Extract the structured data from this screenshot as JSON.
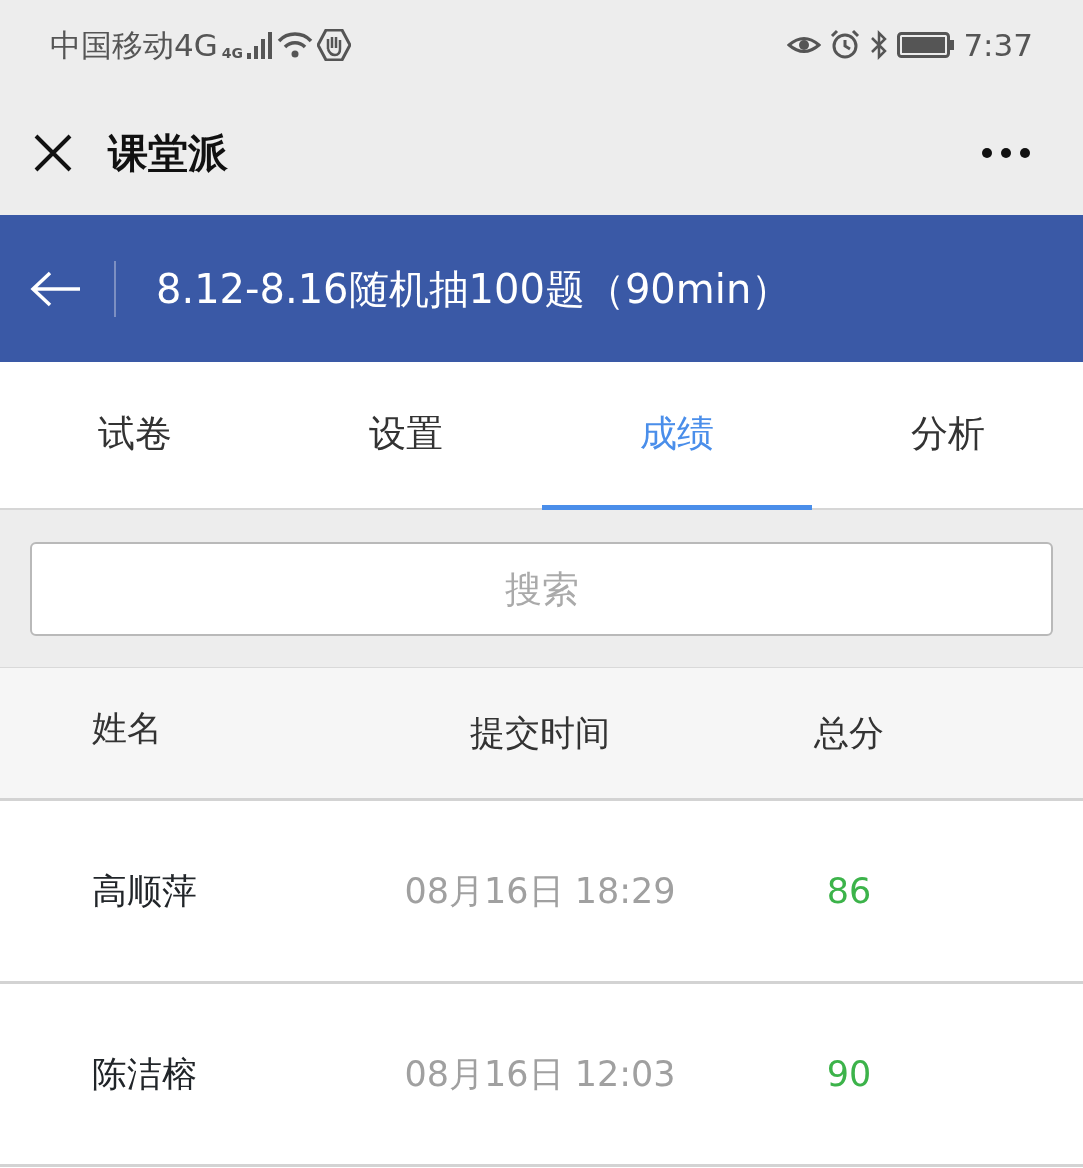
{
  "status_bar": {
    "carrier": "中国移动4G",
    "network_badge": "4G",
    "time": "7:37"
  },
  "app_bar": {
    "title": "课堂派"
  },
  "header": {
    "title": "8.12-8.16随机抽100题（90min）"
  },
  "tabs": [
    {
      "label": "试卷",
      "selected": false
    },
    {
      "label": "设置",
      "selected": false
    },
    {
      "label": "成绩",
      "selected": true
    },
    {
      "label": "分析",
      "selected": false
    }
  ],
  "search": {
    "placeholder": "搜索"
  },
  "table": {
    "columns": [
      "姓名",
      "提交时间",
      "总分"
    ],
    "rows": [
      {
        "name": "高顺萍",
        "time": "08月16日 18:29",
        "score": "86"
      },
      {
        "name": "陈洁榕",
        "time": "08月16日 12:03",
        "score": "90"
      }
    ]
  }
}
